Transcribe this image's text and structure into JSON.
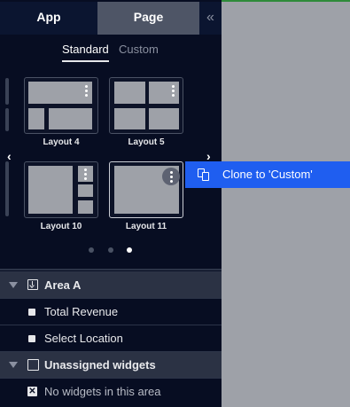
{
  "tabs": {
    "app": "App",
    "page": "Page",
    "collapse": "«"
  },
  "subtabs": {
    "standard": "Standard",
    "custom": "Custom"
  },
  "layouts": [
    {
      "label": "Layout 4"
    },
    {
      "label": "Layout 5"
    },
    {
      "label": "Layout 10"
    },
    {
      "label": "Layout 11"
    }
  ],
  "carousel": {
    "prev": "‹",
    "next": "›",
    "pages": 3,
    "active_page": 3
  },
  "context_menu": {
    "clone_label": "Clone to 'Custom'"
  },
  "areas": {
    "area_a": {
      "title": "Area A",
      "items": [
        "Total Revenue",
        "Select Location"
      ]
    },
    "unassigned": {
      "title": "Unassigned widgets",
      "empty_text": "No widgets in this area"
    }
  },
  "colors": {
    "panel_bg": "#070d22",
    "active_tab": "#4e5566",
    "menu_highlight": "#1f5ef0",
    "group_row": "#2b3244",
    "canvas": "#9ea1a8"
  }
}
